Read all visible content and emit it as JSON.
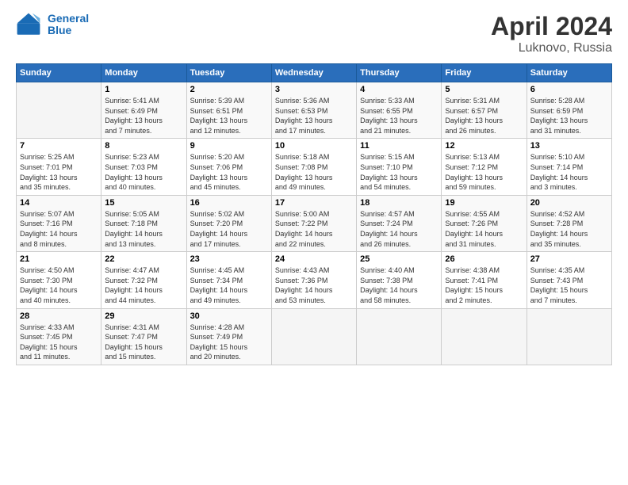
{
  "header": {
    "logo_line1": "General",
    "logo_line2": "Blue",
    "title": "April 2024",
    "subtitle": "Luknovo, Russia"
  },
  "weekdays": [
    "Sunday",
    "Monday",
    "Tuesday",
    "Wednesday",
    "Thursday",
    "Friday",
    "Saturday"
  ],
  "weeks": [
    [
      {
        "day": "",
        "info": ""
      },
      {
        "day": "1",
        "info": "Sunrise: 5:41 AM\nSunset: 6:49 PM\nDaylight: 13 hours\nand 7 minutes."
      },
      {
        "day": "2",
        "info": "Sunrise: 5:39 AM\nSunset: 6:51 PM\nDaylight: 13 hours\nand 12 minutes."
      },
      {
        "day": "3",
        "info": "Sunrise: 5:36 AM\nSunset: 6:53 PM\nDaylight: 13 hours\nand 17 minutes."
      },
      {
        "day": "4",
        "info": "Sunrise: 5:33 AM\nSunset: 6:55 PM\nDaylight: 13 hours\nand 21 minutes."
      },
      {
        "day": "5",
        "info": "Sunrise: 5:31 AM\nSunset: 6:57 PM\nDaylight: 13 hours\nand 26 minutes."
      },
      {
        "day": "6",
        "info": "Sunrise: 5:28 AM\nSunset: 6:59 PM\nDaylight: 13 hours\nand 31 minutes."
      }
    ],
    [
      {
        "day": "7",
        "info": "Sunrise: 5:25 AM\nSunset: 7:01 PM\nDaylight: 13 hours\nand 35 minutes."
      },
      {
        "day": "8",
        "info": "Sunrise: 5:23 AM\nSunset: 7:03 PM\nDaylight: 13 hours\nand 40 minutes."
      },
      {
        "day": "9",
        "info": "Sunrise: 5:20 AM\nSunset: 7:06 PM\nDaylight: 13 hours\nand 45 minutes."
      },
      {
        "day": "10",
        "info": "Sunrise: 5:18 AM\nSunset: 7:08 PM\nDaylight: 13 hours\nand 49 minutes."
      },
      {
        "day": "11",
        "info": "Sunrise: 5:15 AM\nSunset: 7:10 PM\nDaylight: 13 hours\nand 54 minutes."
      },
      {
        "day": "12",
        "info": "Sunrise: 5:13 AM\nSunset: 7:12 PM\nDaylight: 13 hours\nand 59 minutes."
      },
      {
        "day": "13",
        "info": "Sunrise: 5:10 AM\nSunset: 7:14 PM\nDaylight: 14 hours\nand 3 minutes."
      }
    ],
    [
      {
        "day": "14",
        "info": "Sunrise: 5:07 AM\nSunset: 7:16 PM\nDaylight: 14 hours\nand 8 minutes."
      },
      {
        "day": "15",
        "info": "Sunrise: 5:05 AM\nSunset: 7:18 PM\nDaylight: 14 hours\nand 13 minutes."
      },
      {
        "day": "16",
        "info": "Sunrise: 5:02 AM\nSunset: 7:20 PM\nDaylight: 14 hours\nand 17 minutes."
      },
      {
        "day": "17",
        "info": "Sunrise: 5:00 AM\nSunset: 7:22 PM\nDaylight: 14 hours\nand 22 minutes."
      },
      {
        "day": "18",
        "info": "Sunrise: 4:57 AM\nSunset: 7:24 PM\nDaylight: 14 hours\nand 26 minutes."
      },
      {
        "day": "19",
        "info": "Sunrise: 4:55 AM\nSunset: 7:26 PM\nDaylight: 14 hours\nand 31 minutes."
      },
      {
        "day": "20",
        "info": "Sunrise: 4:52 AM\nSunset: 7:28 PM\nDaylight: 14 hours\nand 35 minutes."
      }
    ],
    [
      {
        "day": "21",
        "info": "Sunrise: 4:50 AM\nSunset: 7:30 PM\nDaylight: 14 hours\nand 40 minutes."
      },
      {
        "day": "22",
        "info": "Sunrise: 4:47 AM\nSunset: 7:32 PM\nDaylight: 14 hours\nand 44 minutes."
      },
      {
        "day": "23",
        "info": "Sunrise: 4:45 AM\nSunset: 7:34 PM\nDaylight: 14 hours\nand 49 minutes."
      },
      {
        "day": "24",
        "info": "Sunrise: 4:43 AM\nSunset: 7:36 PM\nDaylight: 14 hours\nand 53 minutes."
      },
      {
        "day": "25",
        "info": "Sunrise: 4:40 AM\nSunset: 7:38 PM\nDaylight: 14 hours\nand 58 minutes."
      },
      {
        "day": "26",
        "info": "Sunrise: 4:38 AM\nSunset: 7:41 PM\nDaylight: 15 hours\nand 2 minutes."
      },
      {
        "day": "27",
        "info": "Sunrise: 4:35 AM\nSunset: 7:43 PM\nDaylight: 15 hours\nand 7 minutes."
      }
    ],
    [
      {
        "day": "28",
        "info": "Sunrise: 4:33 AM\nSunset: 7:45 PM\nDaylight: 15 hours\nand 11 minutes."
      },
      {
        "day": "29",
        "info": "Sunrise: 4:31 AM\nSunset: 7:47 PM\nDaylight: 15 hours\nand 15 minutes."
      },
      {
        "day": "30",
        "info": "Sunrise: 4:28 AM\nSunset: 7:49 PM\nDaylight: 15 hours\nand 20 minutes."
      },
      {
        "day": "",
        "info": ""
      },
      {
        "day": "",
        "info": ""
      },
      {
        "day": "",
        "info": ""
      },
      {
        "day": "",
        "info": ""
      }
    ]
  ]
}
